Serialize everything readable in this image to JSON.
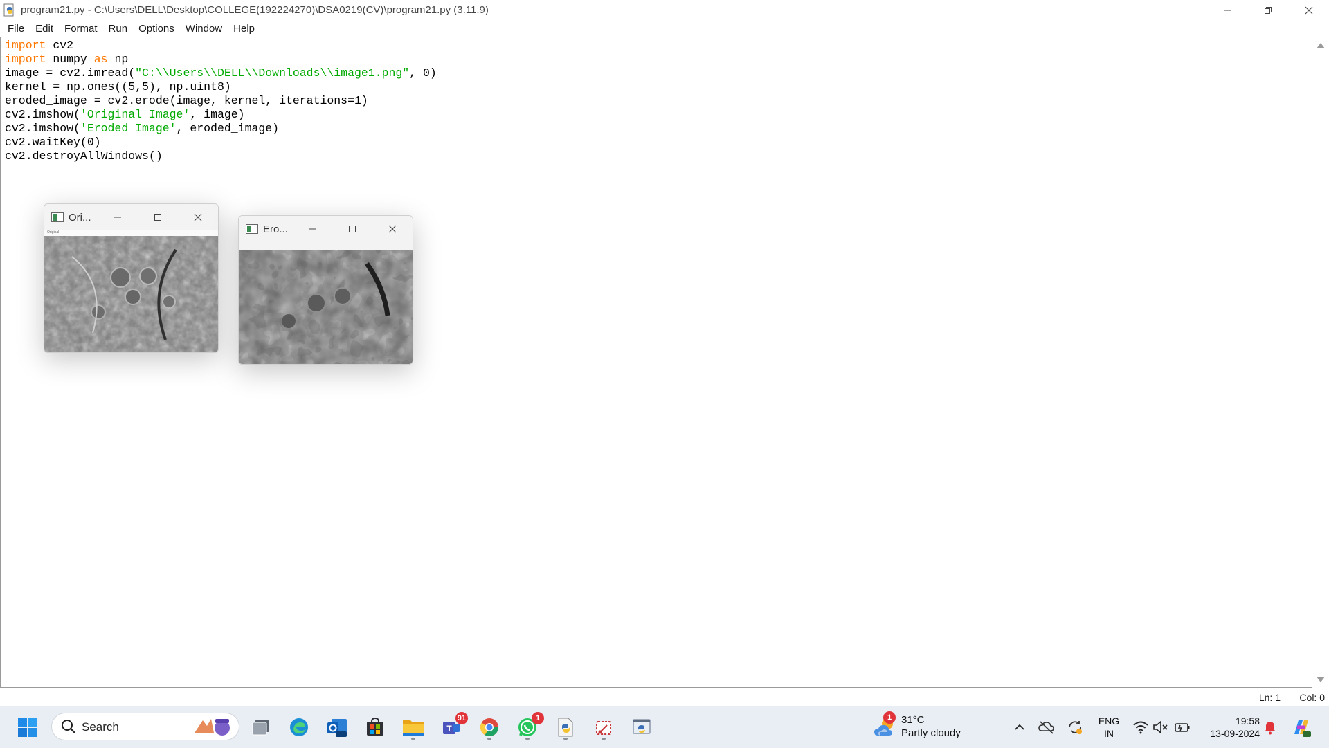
{
  "window": {
    "title": "program21.py - C:\\Users\\DELL\\Desktop\\COLLEGE(192224270)\\DSA0219(CV)\\program21.py (3.11.9)"
  },
  "menu": [
    "File",
    "Edit",
    "Format",
    "Run",
    "Options",
    "Window",
    "Help"
  ],
  "code_lines": [
    [
      {
        "t": "import",
        "c": "kw"
      },
      {
        "t": " cv2"
      }
    ],
    [
      {
        "t": "import",
        "c": "kw"
      },
      {
        "t": " numpy "
      },
      {
        "t": "as",
        "c": "kw"
      },
      {
        "t": " np"
      }
    ],
    [
      {
        "t": "image = cv2.imread("
      },
      {
        "t": "\"C:\\\\Users\\\\DELL\\\\Downloads\\\\image1.png\"",
        "c": "str"
      },
      {
        "t": ", 0)"
      }
    ],
    [
      {
        "t": "kernel = np.ones((5,5), np.uint8)"
      }
    ],
    [
      {
        "t": "eroded_image = cv2.erode(image, kernel, iterations=1)"
      }
    ],
    [
      {
        "t": "cv2.imshow("
      },
      {
        "t": "'Original Image'",
        "c": "str"
      },
      {
        "t": ", image)"
      }
    ],
    [
      {
        "t": "cv2.imshow("
      },
      {
        "t": "'Eroded Image'",
        "c": "str"
      },
      {
        "t": ", eroded_image)"
      }
    ],
    [
      {
        "t": "cv2.waitKey(0)"
      }
    ],
    [
      {
        "t": "cv2.destroyAllWindows()"
      }
    ]
  ],
  "status": {
    "ln": "Ln: 1",
    "col": "Col: 0"
  },
  "cv_windows": {
    "original": {
      "title": "Ori...",
      "inner_title": "Original"
    },
    "eroded": {
      "title": "Ero..."
    }
  },
  "taskbar": {
    "search_label": "Search",
    "badges": {
      "teams": "91",
      "whatsapp": "1",
      "weather": "1"
    },
    "weather": {
      "temp": "31°C",
      "desc": "Partly cloudy"
    },
    "lang": {
      "line1": "ENG",
      "line2": "IN"
    },
    "clock": {
      "time": "19:58",
      "date": "13-09-2024"
    }
  },
  "colors": {
    "keyword": "#ff7700",
    "string": "#00aa00",
    "taskbar": "#e9eef4",
    "badge": "#e0333a"
  },
  "icons": [
    "python-idle-icon",
    "windows-start-icon",
    "search-icon",
    "task-view-icon",
    "edge-icon",
    "outlook-icon",
    "store-icon",
    "file-explorer-icon",
    "teams-icon",
    "chrome-icon",
    "whatsapp-icon",
    "python-file-icon",
    "snipping-tool-icon",
    "python-idle-taskbar-icon",
    "chevron-up-icon",
    "onedrive-offline-icon",
    "sync-icon",
    "wifi-icon",
    "speaker-muted-icon",
    "battery-icon",
    "notification-bell-icon",
    "copilot-icon"
  ]
}
